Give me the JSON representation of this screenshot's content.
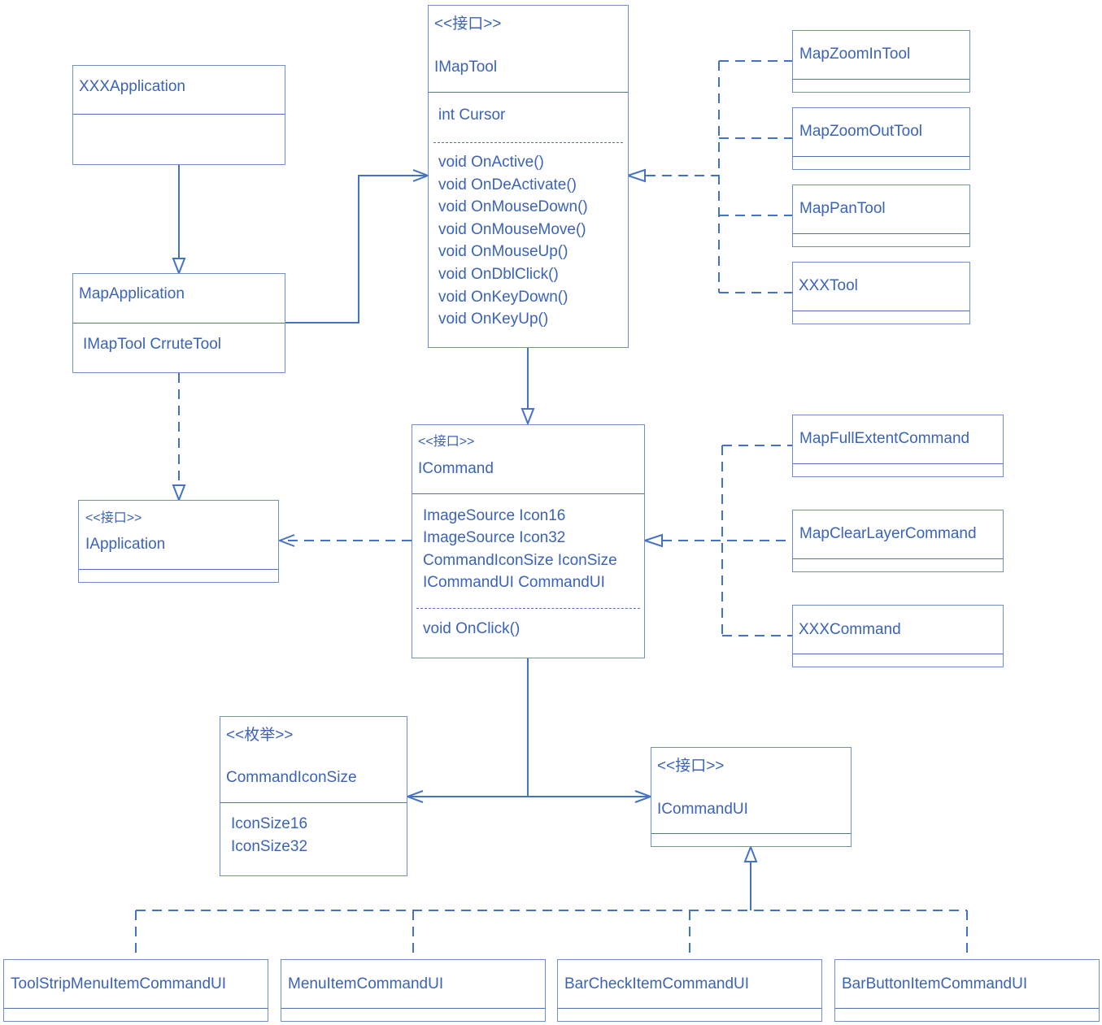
{
  "diagram": {
    "type": "uml-class-diagram",
    "line_color": "#4472C4",
    "text_color": "#3B63B6",
    "classes": {
      "xxx_application": {
        "name": "XXXApplication",
        "attributes": []
      },
      "map_application": {
        "name": "MapApplication",
        "attributes": [
          "IMapTool CrruteTool"
        ]
      },
      "iapplication": {
        "stereotype": "<<接口>>",
        "name": "IApplication"
      },
      "imaptool": {
        "stereotype": "<<接口>>",
        "name": "IMapTool",
        "attributes": [
          "int Cursor"
        ],
        "methods": [
          "void OnActive()",
          "void OnDeActivate()",
          "void OnMouseDown()",
          "void OnMouseMove()",
          "void OnMouseUp()",
          "void OnDblClick()",
          "void OnKeyDown()",
          "void OnKeyUp()"
        ]
      },
      "icommand": {
        "stereotype": "<<接口>>",
        "name": "ICommand",
        "attributes": [
          "ImageSource Icon16",
          "ImageSource Icon32",
          "CommandIconSize IconSize",
          "ICommandUI CommandUI"
        ],
        "methods": [
          "void OnClick()"
        ]
      },
      "command_icon_size": {
        "stereotype": "<<枚举>>",
        "name": "CommandIconSize",
        "values": [
          "IconSize16",
          "IconSize32"
        ]
      },
      "icommandui": {
        "stereotype": "<<接口>>",
        "name": "ICommandUI"
      },
      "tools": [
        "MapZoomInTool",
        "MapZoomOutTool",
        "MapPanTool",
        "XXXTool"
      ],
      "commands": [
        "MapFullExtentCommand",
        "MapClearLayerCommand",
        "XXXCommand"
      ],
      "command_uis": [
        "ToolStripMenuItemCommandUI",
        "MenuItemCommandUI",
        "BarCheckItemCommandUI",
        "BarButtonItemCommandUI"
      ]
    },
    "relationships": [
      {
        "from": "XXXApplication",
        "to": "MapApplication",
        "kind": "generalization"
      },
      {
        "from": "MapApplication",
        "to": "IMapTool",
        "kind": "association"
      },
      {
        "from": "MapApplication",
        "to": "IApplication",
        "kind": "realization"
      },
      {
        "from": "IMapTool",
        "to": "ICommand",
        "kind": "generalization"
      },
      {
        "from": "MapZoomInTool",
        "to": "IMapTool",
        "kind": "realization"
      },
      {
        "from": "MapZoomOutTool",
        "to": "IMapTool",
        "kind": "realization"
      },
      {
        "from": "MapPanTool",
        "to": "IMapTool",
        "kind": "realization"
      },
      {
        "from": "XXXTool",
        "to": "IMapTool",
        "kind": "realization"
      },
      {
        "from": "ICommand",
        "to": "IApplication",
        "kind": "dependency"
      },
      {
        "from": "MapFullExtentCommand",
        "to": "ICommand",
        "kind": "realization"
      },
      {
        "from": "MapClearLayerCommand",
        "to": "ICommand",
        "kind": "realization"
      },
      {
        "from": "XXXCommand",
        "to": "ICommand",
        "kind": "realization"
      },
      {
        "from": "ICommand",
        "to": "CommandIconSize",
        "kind": "association"
      },
      {
        "from": "ICommand",
        "to": "ICommandUI",
        "kind": "association"
      },
      {
        "from": "ToolStripMenuItemCommandUI",
        "to": "ICommandUI",
        "kind": "realization"
      },
      {
        "from": "MenuItemCommandUI",
        "to": "ICommandUI",
        "kind": "realization"
      },
      {
        "from": "BarCheckItemCommandUI",
        "to": "ICommandUI",
        "kind": "realization"
      },
      {
        "from": "BarButtonItemCommandUI",
        "to": "ICommandUI",
        "kind": "realization"
      }
    ]
  }
}
